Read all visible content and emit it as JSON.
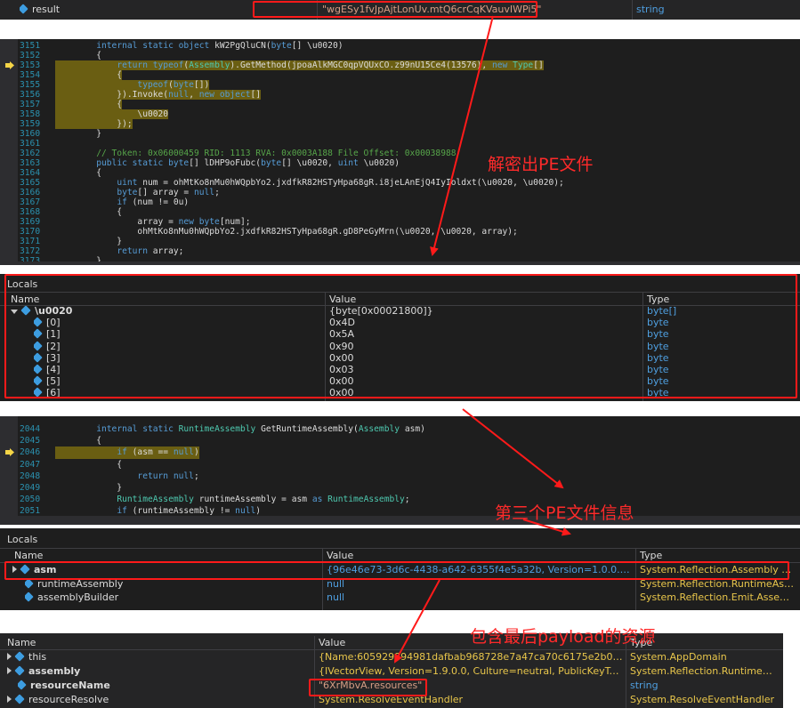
{
  "top_row": {
    "name": "result",
    "value": "\"wgESy1fvJpAjtLonUv.mtQ6crCqKVauvIWPi5\"",
    "type": "string"
  },
  "code1": {
    "lines": [
      {
        "n": "3151",
        "t": "        internal static object kW2PgQluCN(byte[] \\u0020)"
      },
      {
        "n": "3152",
        "t": "        {"
      },
      {
        "n": "3153",
        "t": "            return typeof(Assembly).GetMethod(jpoaAlkMGC0qpVQUxCO.z99nU15Ce4(13576), new Type[]"
      },
      {
        "n": "3154",
        "t": "            {"
      },
      {
        "n": "3155",
        "t": "                typeof(byte[])"
      },
      {
        "n": "3156",
        "t": "            }).Invoke(null, new object[]"
      },
      {
        "n": "3157",
        "t": "            {"
      },
      {
        "n": "3158",
        "t": "                \\u0020"
      },
      {
        "n": "3159",
        "t": "            });"
      },
      {
        "n": "3160",
        "t": "        }"
      },
      {
        "n": "3161",
        "t": ""
      },
      {
        "n": "3162",
        "t": "        // Token: 0x06000459 RID: 1113 RVA: 0x0003A188 File Offset: 0x00038988"
      },
      {
        "n": "3163",
        "t": "        public static byte[] lDHP9oFubc(byte[] \\u0020, uint \\u0020)"
      },
      {
        "n": "3164",
        "t": "        {"
      },
      {
        "n": "3165",
        "t": "            uint num = ohMtKo8nMu0hWQpbYo2.jxdfkR82HSTyHpa68gR.i8jeLAnEjQ4IyIoldxt(\\u0020, \\u0020);"
      },
      {
        "n": "3166",
        "t": "            byte[] array = null;"
      },
      {
        "n": "3167",
        "t": "            if (num != 0u)"
      },
      {
        "n": "3168",
        "t": "            {"
      },
      {
        "n": "3169",
        "t": "                array = new byte[num];"
      },
      {
        "n": "3170",
        "t": "                ohMtKo8nMu0hWQpbYo2.jxdfkR82HSTyHpa68gR.gD8PeGyMrn(\\u0020, \\u0020, array);"
      },
      {
        "n": "3171",
        "t": "            }"
      },
      {
        "n": "3172",
        "t": "            return array;"
      },
      {
        "n": "3173",
        "t": "        }"
      }
    ]
  },
  "locals1": {
    "title": "Locals",
    "headers": {
      "name": "Name",
      "value": "Value",
      "type": "Type"
    },
    "rows": [
      {
        "name": "\\u0020",
        "value": "{byte[0x00021800]}",
        "type": "byte[]"
      },
      {
        "name": "[0]",
        "value": "0x4D",
        "type": "byte"
      },
      {
        "name": "[1]",
        "value": "0x5A",
        "type": "byte"
      },
      {
        "name": "[2]",
        "value": "0x90",
        "type": "byte"
      },
      {
        "name": "[3]",
        "value": "0x00",
        "type": "byte"
      },
      {
        "name": "[4]",
        "value": "0x03",
        "type": "byte"
      },
      {
        "name": "[5]",
        "value": "0x00",
        "type": "byte"
      },
      {
        "name": "[6]",
        "value": "0x00",
        "type": "byte"
      }
    ]
  },
  "code2": {
    "lines": [
      {
        "n": "2044",
        "t": "        internal static RuntimeAssembly GetRuntimeAssembly(Assembly asm)"
      },
      {
        "n": "2045",
        "t": "        {"
      },
      {
        "n": "2046",
        "t": "            if (asm == null)"
      },
      {
        "n": "2047",
        "t": "            {"
      },
      {
        "n": "2048",
        "t": "                return null;"
      },
      {
        "n": "2049",
        "t": "            }"
      },
      {
        "n": "2050",
        "t": "            RuntimeAssembly runtimeAssembly = asm as RuntimeAssembly;"
      },
      {
        "n": "2051",
        "t": "            if (runtimeAssembly != null)"
      }
    ]
  },
  "locals2": {
    "title": "Locals",
    "headers": {
      "name": "Name",
      "value": "Value",
      "type": "Type"
    },
    "rows": [
      {
        "name": "asm",
        "value": "{96e46e73-3d6c-4438-a642-6355f4e5a32b, Version=1.0.0.0, Cultu...",
        "type": "System.Reflection.Assembly {Sy..."
      },
      {
        "name": "runtimeAssembly",
        "value": "null",
        "type": "System.Reflection.RuntimeAsse..."
      },
      {
        "name": "assemblyBuilder",
        "value": "null",
        "type": "System.Reflection.Emit.Assembl..."
      }
    ]
  },
  "locals3": {
    "headers": {
      "name": "Name",
      "value": "Value",
      "type": "Type"
    },
    "rows": [
      {
        "name": "this",
        "value": "{Name:605929894981dafbab968728e7a47ca70c6175e2b0c2394b...",
        "type": "System.AppDomain"
      },
      {
        "name": "assembly",
        "value": "{IVectorView, Version=1.9.0.0, Culture=neutral, PublicKeyToken=n...",
        "type": "System.Reflection.RuntimeAsse..."
      },
      {
        "name": "resourceName",
        "value": "\"6XrMbvA.resources\"",
        "type": "string"
      },
      {
        "name": "resourceResolve",
        "value": "System.ResolveEventHandler",
        "type": "System.ResolveEventHandler"
      }
    ]
  },
  "annotations": {
    "decrypt_pe": "解密出PE文件",
    "third_pe": "第三个PE文件信息",
    "payload_res": "包含最后payload的资源"
  },
  "colors": {
    "annotation_red": "#ff1a1a",
    "panel_bg": "#1e1e1e",
    "line_number": "#2b91af",
    "highlight": "#6a5e12"
  }
}
